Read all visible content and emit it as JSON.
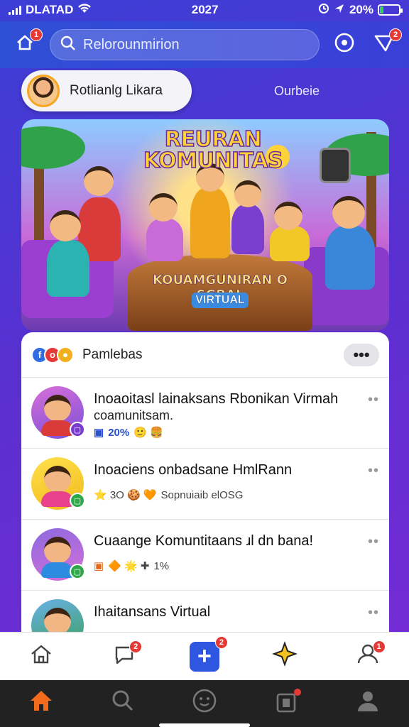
{
  "status": {
    "carrier": "DLATAD",
    "time": "2027",
    "battery": "20%",
    "battery_level": 0.2
  },
  "header": {
    "left_badge": "1",
    "search_placeholder": "Relorounmirion",
    "right_badge": "2"
  },
  "profile": {
    "name": "Rotlianlg Likara",
    "side_link": "Ourbeie"
  },
  "banner": {
    "title": "REURAN KOMUNITAS",
    "subtitle": "KOUAMGUNIRAN O SGBAL",
    "tag": "VIRTUAL"
  },
  "feed": {
    "header_title": "Pamlebas",
    "more_label": "•••",
    "posts": [
      {
        "title": "Inoaoitasl lainaksans Rbonikan Virmah",
        "subtitle": "coamunitsam.",
        "meta": "20%",
        "meta_icons": "🙂 🍔",
        "more": "••"
      },
      {
        "title": "Inoaciens onbadsane HmlRann",
        "subtitle": "",
        "meta": "Sopnuiaib elOSG",
        "meta_icons": "⭐ 3O 🍪 🧡",
        "more": "••"
      },
      {
        "title": "Cuaange Komuntitaans ɹl dn bana!",
        "subtitle": "",
        "meta": "1%",
        "meta_icons": "🔶 🌟 ✚",
        "more": "••"
      },
      {
        "title": "Ihaitansans Virtual",
        "subtitle": "",
        "meta": "",
        "meta_icons": "",
        "more": "••"
      }
    ]
  },
  "tabbar": {
    "chat_badge": "2",
    "plus_badge": "2",
    "profile_badge": "1"
  },
  "colors": {
    "accent": "#2f56e0",
    "badge": "#e53935",
    "active_nav": "#f26b1d"
  }
}
